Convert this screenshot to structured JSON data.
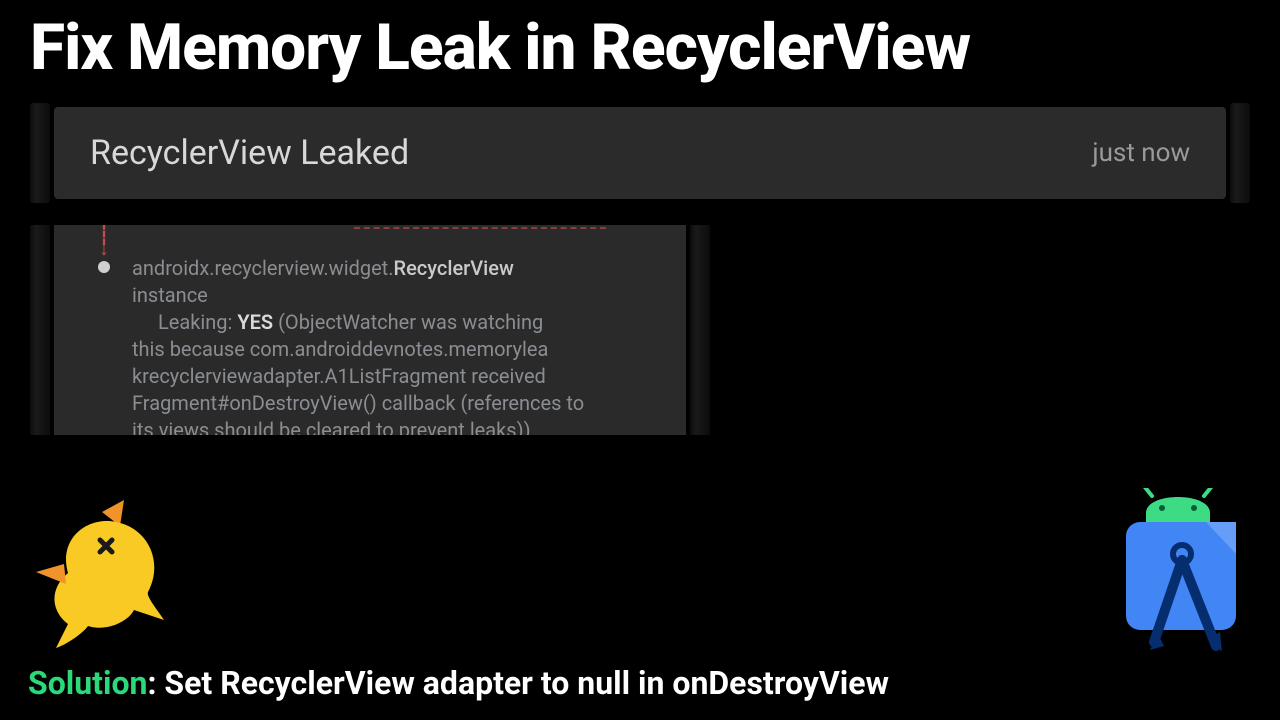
{
  "title": "Fix Memory Leak in RecyclerView",
  "notification": {
    "title": "RecyclerView Leaked",
    "time": "just now"
  },
  "leak": {
    "class_prefix": "androidx.recyclerview.widget.",
    "class_name": "RecyclerView",
    "instance_word": "instance",
    "leaking_label": "Leaking:",
    "leaking_value": "YES",
    "detail_after_yes": " (ObjectWatcher was watching",
    "detail_line2": "this because com.androiddevnotes.memorylea",
    "detail_line3": "krecyclerviewadapter.A1ListFragment received",
    "detail_line4": "Fragment#onDestroyView() callback (references to",
    "detail_line5": "its views should be cleared to prevent leaks))"
  },
  "solution": {
    "label": "Solution",
    "text": ": Set RecyclerView adapter to null in onDestroyView"
  },
  "icons": {
    "bird": "leakcanary-bird-icon",
    "android": "android-studio-icon"
  },
  "colors": {
    "accent_green": "#2bd97a",
    "bird_yellow": "#f9ca24",
    "bird_orange": "#f0932b",
    "android_green": "#3ddc84",
    "android_blue": "#4285f4"
  }
}
